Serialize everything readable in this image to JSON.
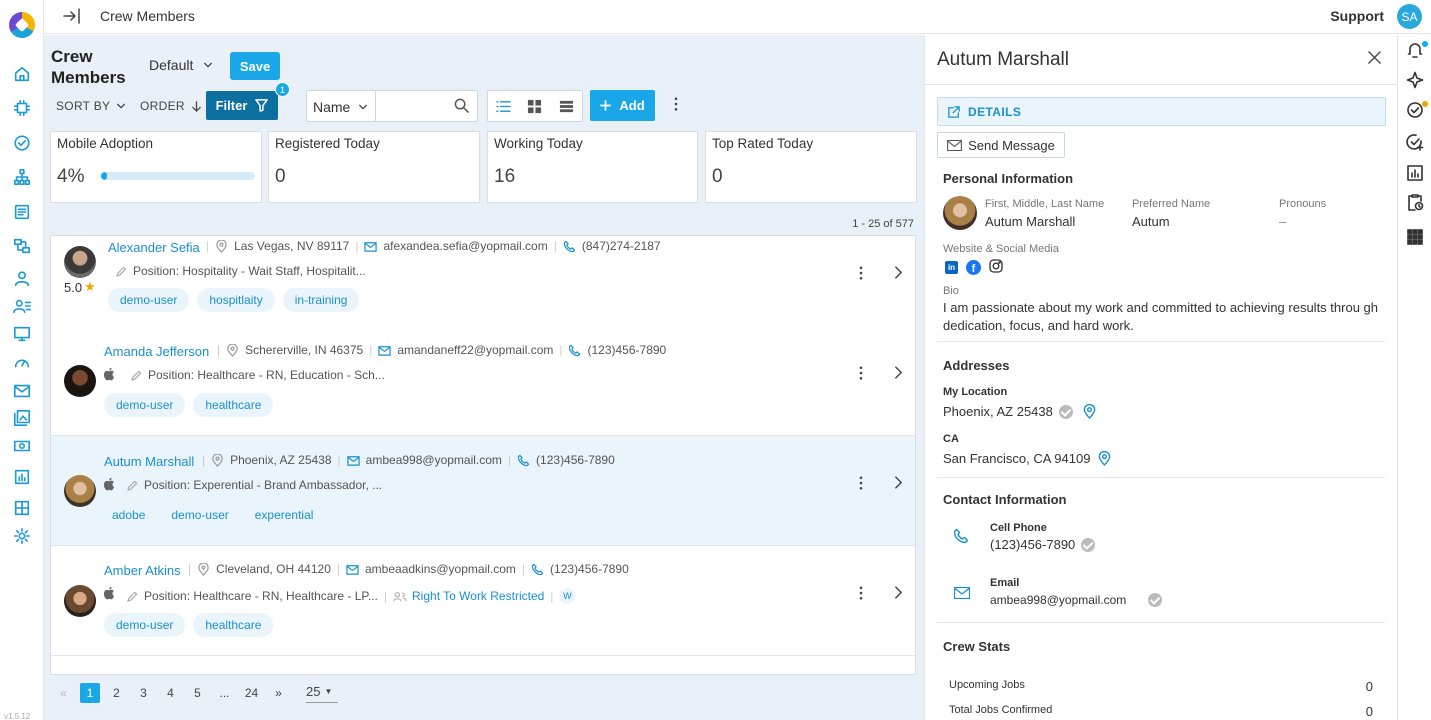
{
  "app": {
    "page_title": "Crew Members",
    "version": "v1.5.12"
  },
  "topbar": {
    "support_label": "Support",
    "avatar_initials": "SA"
  },
  "list_header": {
    "title": "Crew Members",
    "view_selected": "Default",
    "save_label": "Save",
    "sort_by_label": "SORT BY",
    "order_label": "ORDER",
    "filter_label": "Filter",
    "filter_count": "1",
    "search_field": "Name",
    "search_placeholder": "",
    "add_label": "Add"
  },
  "stats": [
    {
      "label": "Mobile Adoption",
      "value": "4%",
      "progress": 0.04
    },
    {
      "label": "Registered Today",
      "value": "0"
    },
    {
      "label": "Working Today",
      "value": "16"
    },
    {
      "label": "Top Rated Today",
      "value": "0"
    }
  ],
  "range_text": "1 - 25 of 577",
  "members": [
    {
      "name": "Alexander Sefia",
      "rating": "5.0",
      "location": "Las Vegas, NV 89117",
      "email": "afexandea.sefia@yopmail.com",
      "phone": "(847)274-2187",
      "position": "Position: Hospitality - Wait Staff, Hospitalit...",
      "tags": [
        "demo-user",
        "hospitlaity",
        "in-training"
      ]
    },
    {
      "name": "Amanda Jefferson",
      "location": "Schererville, IN 46375",
      "email": "amandaneff22@yopmail.com",
      "phone": "(123)456-7890",
      "position": "Position: Healthcare - RN, Education - Sch...",
      "tags": [
        "demo-user",
        "healthcare"
      ]
    },
    {
      "name": "Autum Marshall",
      "location": "Phoenix, AZ 25438",
      "email": "ambea998@yopmail.com",
      "phone": "(123)456-7890",
      "position": "Position: Experential - Brand Ambassador, ...",
      "tags": [
        "adobe",
        "demo-user",
        "experential"
      ]
    },
    {
      "name": "Amber Atkins",
      "location": "Cleveland, OH 44120",
      "email": "ambeaadkins@yopmail.com",
      "phone": "(123)456-7890",
      "position": "Position: Healthcare - RN, Healthcare - LP...",
      "restriction": "Right To Work Restricted",
      "restriction_badge": "W",
      "tags": [
        "demo-user",
        "healthcare"
      ]
    }
  ],
  "pagination": {
    "pages": [
      "1",
      "2",
      "3",
      "4",
      "5",
      "...",
      "24"
    ],
    "current": "1",
    "page_size": "25"
  },
  "detail": {
    "name": "Autum Marshall",
    "details_tab": "DETAILS",
    "send_message": "Send Message",
    "personal_info_heading": "Personal Information",
    "name_label": "First, Middle, Last Name",
    "name_value": "Autum Marshall",
    "preferred_label": "Preferred Name",
    "preferred_value": "Autum",
    "pronouns_label": "Pronouns",
    "pronouns_value": "–",
    "social_label": "Website & Social Media",
    "bio_label": "Bio",
    "bio_text": "I am passionate about my work and committed to achieving results throu gh dedication, focus, and hard work.",
    "addresses_heading": "Addresses",
    "addresses": [
      {
        "label": "My Location",
        "value": "Phoenix, AZ 25438",
        "verified": true
      },
      {
        "label": "CA",
        "value": "San Francisco, CA 94109",
        "verified": false
      }
    ],
    "contact_heading": "Contact Information",
    "cell_label": "Cell Phone",
    "cell_value": "(123)456-7890",
    "email_label": "Email",
    "email_value": "ambea998@yopmail.com",
    "crew_stats_heading": "Crew Stats",
    "crew_stats": [
      {
        "label": "Upcoming Jobs",
        "value": "0"
      },
      {
        "label": "Total Jobs Confirmed",
        "value": "0"
      }
    ]
  },
  "colors": {
    "accent": "#1aa7e8",
    "filter": "#0b6fa0",
    "link": "#1a8fd0",
    "selected_row": "#eaf4fb"
  }
}
